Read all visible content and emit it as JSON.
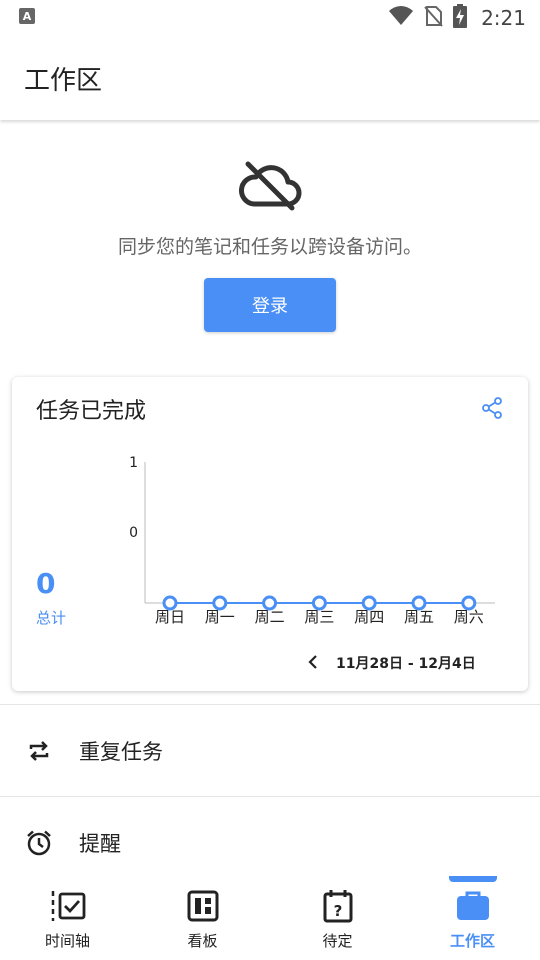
{
  "status_bar": {
    "time": "2:21",
    "app_badge": "A"
  },
  "app_bar": {
    "title": "工作区"
  },
  "sync": {
    "message": "同步您的笔记和任务以跨设备访问。",
    "login_label": "登录"
  },
  "stats_card": {
    "title": "任务已完成",
    "total_value": "0",
    "total_label": "总计",
    "week_range": "11月28日 - 12月4日"
  },
  "chart_data": {
    "type": "line",
    "categories": [
      "周日",
      "周一",
      "周二",
      "周三",
      "周四",
      "周五",
      "周六"
    ],
    "values": [
      0,
      0,
      0,
      0,
      0,
      0,
      0
    ],
    "y_ticks": [
      "1",
      "0"
    ],
    "grid": false,
    "color": "#4a8ff5"
  },
  "menu": [
    {
      "label": "重复任务",
      "icon": "repeat-icon"
    },
    {
      "label": "提醒",
      "icon": "alarm-clock-icon"
    }
  ],
  "bottom_nav": [
    {
      "label": "时间轴",
      "icon": "timeline-icon",
      "active": false
    },
    {
      "label": "看板",
      "icon": "kanban-icon",
      "active": false
    },
    {
      "label": "待定",
      "icon": "pending-calendar-icon",
      "active": false
    },
    {
      "label": "工作区",
      "icon": "briefcase-icon",
      "active": true
    }
  ],
  "colors": {
    "accent": "#4a8ff5"
  }
}
